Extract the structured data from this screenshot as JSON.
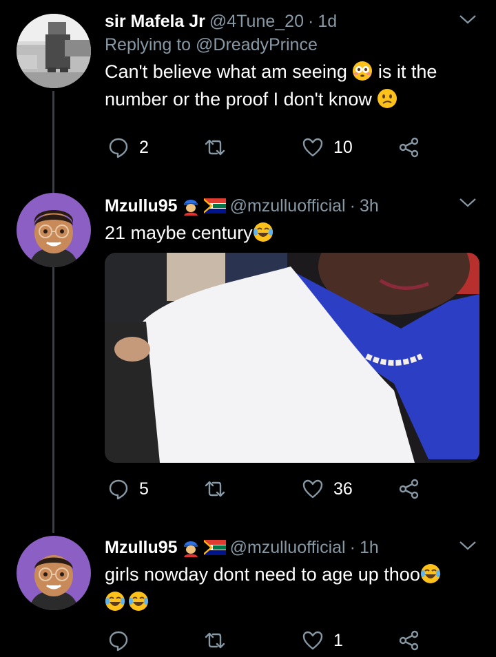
{
  "tweets": [
    {
      "name": "sir Mafela Jr",
      "handle": "@4Tune_20",
      "separator": "·",
      "time": "1d",
      "replying_prefix": "Replying to",
      "replying_to": "@DreadyPrince",
      "text_part1": "Can't believe what am seeing",
      "text_part2": " is it the number or the proof I don't know",
      "replies": "2",
      "retweets": "",
      "likes": "10"
    },
    {
      "name": "Mzullu95",
      "handle": "@mzulluofficial",
      "separator": "·",
      "time": "3h",
      "text": "21 maybe century",
      "replies": "5",
      "retweets": "",
      "likes": "36"
    },
    {
      "name": "Mzullu95",
      "handle": "@mzulluofficial",
      "separator": "·",
      "time": "1h",
      "text": "girls nowday dont need to age up thoo",
      "replies": "",
      "retweets": "",
      "likes": "1"
    }
  ],
  "colors": {
    "background": "#000000",
    "secondary_text": "#8899a6",
    "thread_line": "#3a3f44",
    "avatar_purple": "#8b5fc4"
  },
  "icons": [
    "reply-icon",
    "retweet-icon",
    "like-icon",
    "share-icon",
    "chevron-down-icon"
  ]
}
